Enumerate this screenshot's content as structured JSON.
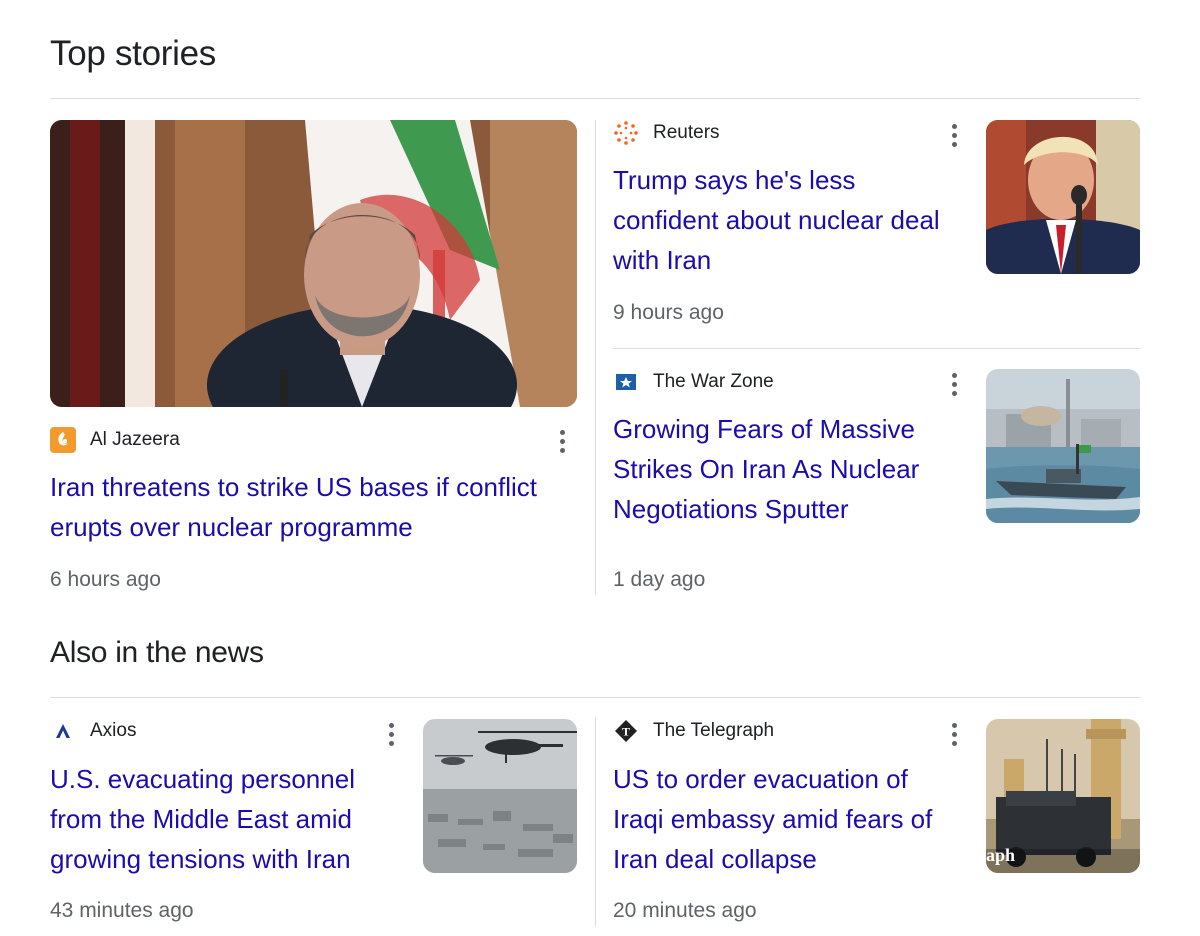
{
  "top_stories": {
    "title": "Top stories",
    "main_story": {
      "source": "Al Jazeera",
      "headline": "Iran threatens to strike US bases if conflict erupts over nuclear programme",
      "time": "6 hours ago",
      "image_alt": "Iranian official speaking in front of the Iranian flag"
    },
    "side_stories": [
      {
        "source": "Reuters",
        "headline": "Trump says he's less confident about nuclear deal with Iran",
        "time": "9 hours ago",
        "image_alt": "Trump speaking at a microphone"
      },
      {
        "source": "The War Zone",
        "headline": "Growing Fears of Massive Strikes On Iran As Nuclear Negotiations Sputter",
        "time": "1 day ago",
        "image_alt": "Fast boat on water near a nuclear plant"
      }
    ]
  },
  "also_in_news": {
    "title": "Also in the news",
    "stories": [
      {
        "source": "Axios",
        "headline": "U.S. evacuating personnel from the Middle East amid growing tensions with Iran",
        "time": "43 minutes ago",
        "image_alt": "Helicopters flying over a city"
      },
      {
        "source": "The Telegraph",
        "headline": "US to order evacuation of Iraqi embassy amid fears of Iran deal collapse",
        "time": "20 minutes ago",
        "image_alt": "Armored vehicle near embassy walls",
        "image_overlay_text": "aph"
      }
    ]
  },
  "colors": {
    "headline": "#1a0dab",
    "time": "#5f6368",
    "divider": "#dadce0",
    "aljazeera": "#f29a2e",
    "reuters": "#f26522",
    "warzone": "#1f5fa8",
    "axios": "#1f3a93"
  },
  "icons": {
    "aljazeera": "aljazeera-logo-icon",
    "reuters": "reuters-logo-icon",
    "warzone": "warzone-logo-icon",
    "axios": "axios-logo-icon",
    "telegraph": "telegraph-logo-icon",
    "more": "more-vert-icon"
  }
}
